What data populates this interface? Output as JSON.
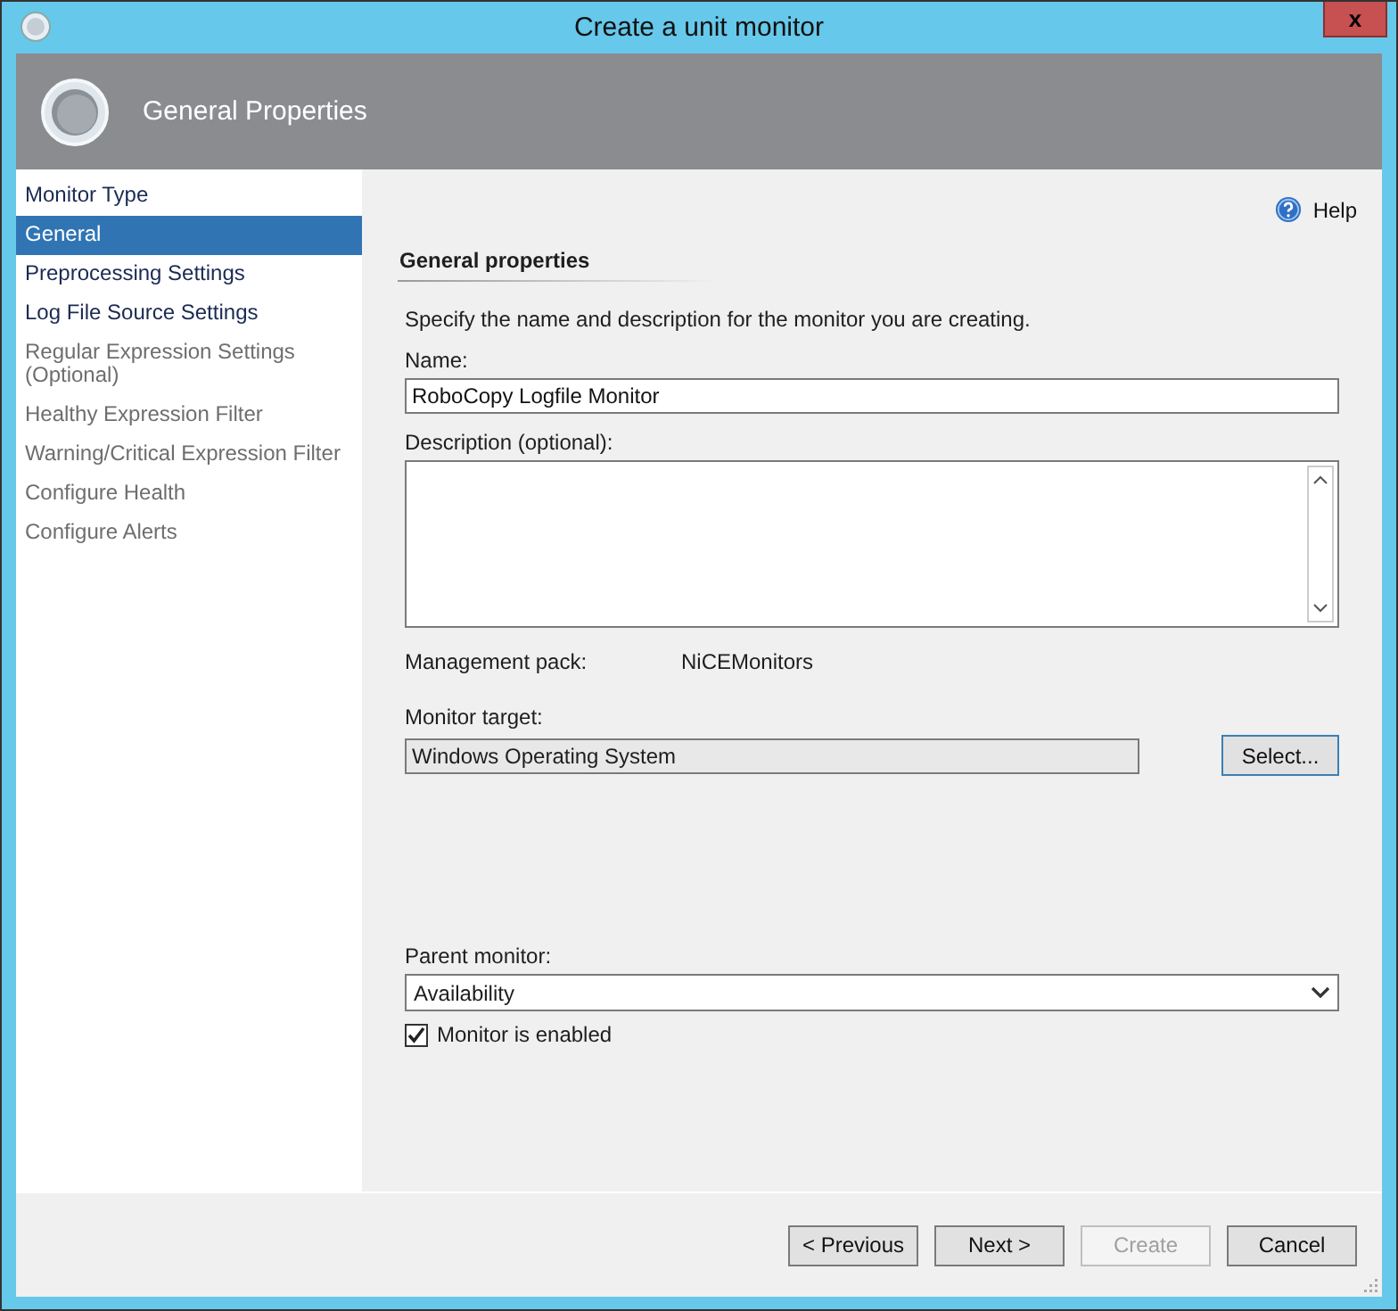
{
  "window": {
    "title": "Create a unit monitor",
    "close": "x"
  },
  "header": {
    "title": "General Properties"
  },
  "sidebar": {
    "items": [
      {
        "label": "Monitor Type",
        "selected": false,
        "disabled": false
      },
      {
        "label": "General",
        "selected": true,
        "disabled": false
      },
      {
        "label": "Preprocessing Settings",
        "selected": false,
        "disabled": false
      },
      {
        "label": "Log File Source Settings",
        "selected": false,
        "disabled": false
      },
      {
        "label": "Regular Expression Settings (Optional)",
        "selected": false,
        "disabled": true
      },
      {
        "label": "Healthy Expression Filter",
        "selected": false,
        "disabled": true
      },
      {
        "label": "Warning/Critical Expression Filter",
        "selected": false,
        "disabled": true
      },
      {
        "label": "Configure Health",
        "selected": false,
        "disabled": true
      },
      {
        "label": "Configure Alerts",
        "selected": false,
        "disabled": true
      }
    ]
  },
  "help": "Help",
  "section": {
    "title": "General properties",
    "description": "Specify the name and description for the monitor you are creating."
  },
  "name": {
    "label": "Name:",
    "value": "RoboCopy Logfile Monitor"
  },
  "description": {
    "label": "Description (optional):"
  },
  "management_pack": {
    "label": "Management pack:",
    "value": "NiCEMonitors"
  },
  "monitor_target": {
    "label": "Monitor target:",
    "value": "Windows Operating System",
    "button": "Select..."
  },
  "parent_monitor": {
    "label": "Parent monitor:",
    "value": "Availability"
  },
  "enabled": {
    "label": "Monitor is enabled",
    "checked": true
  },
  "buttons": [
    {
      "label": "< Previous",
      "disabled": false
    },
    {
      "label": "Next >",
      "disabled": false
    },
    {
      "label": "Create",
      "disabled": true
    },
    {
      "label": "Cancel",
      "disabled": false
    }
  ]
}
